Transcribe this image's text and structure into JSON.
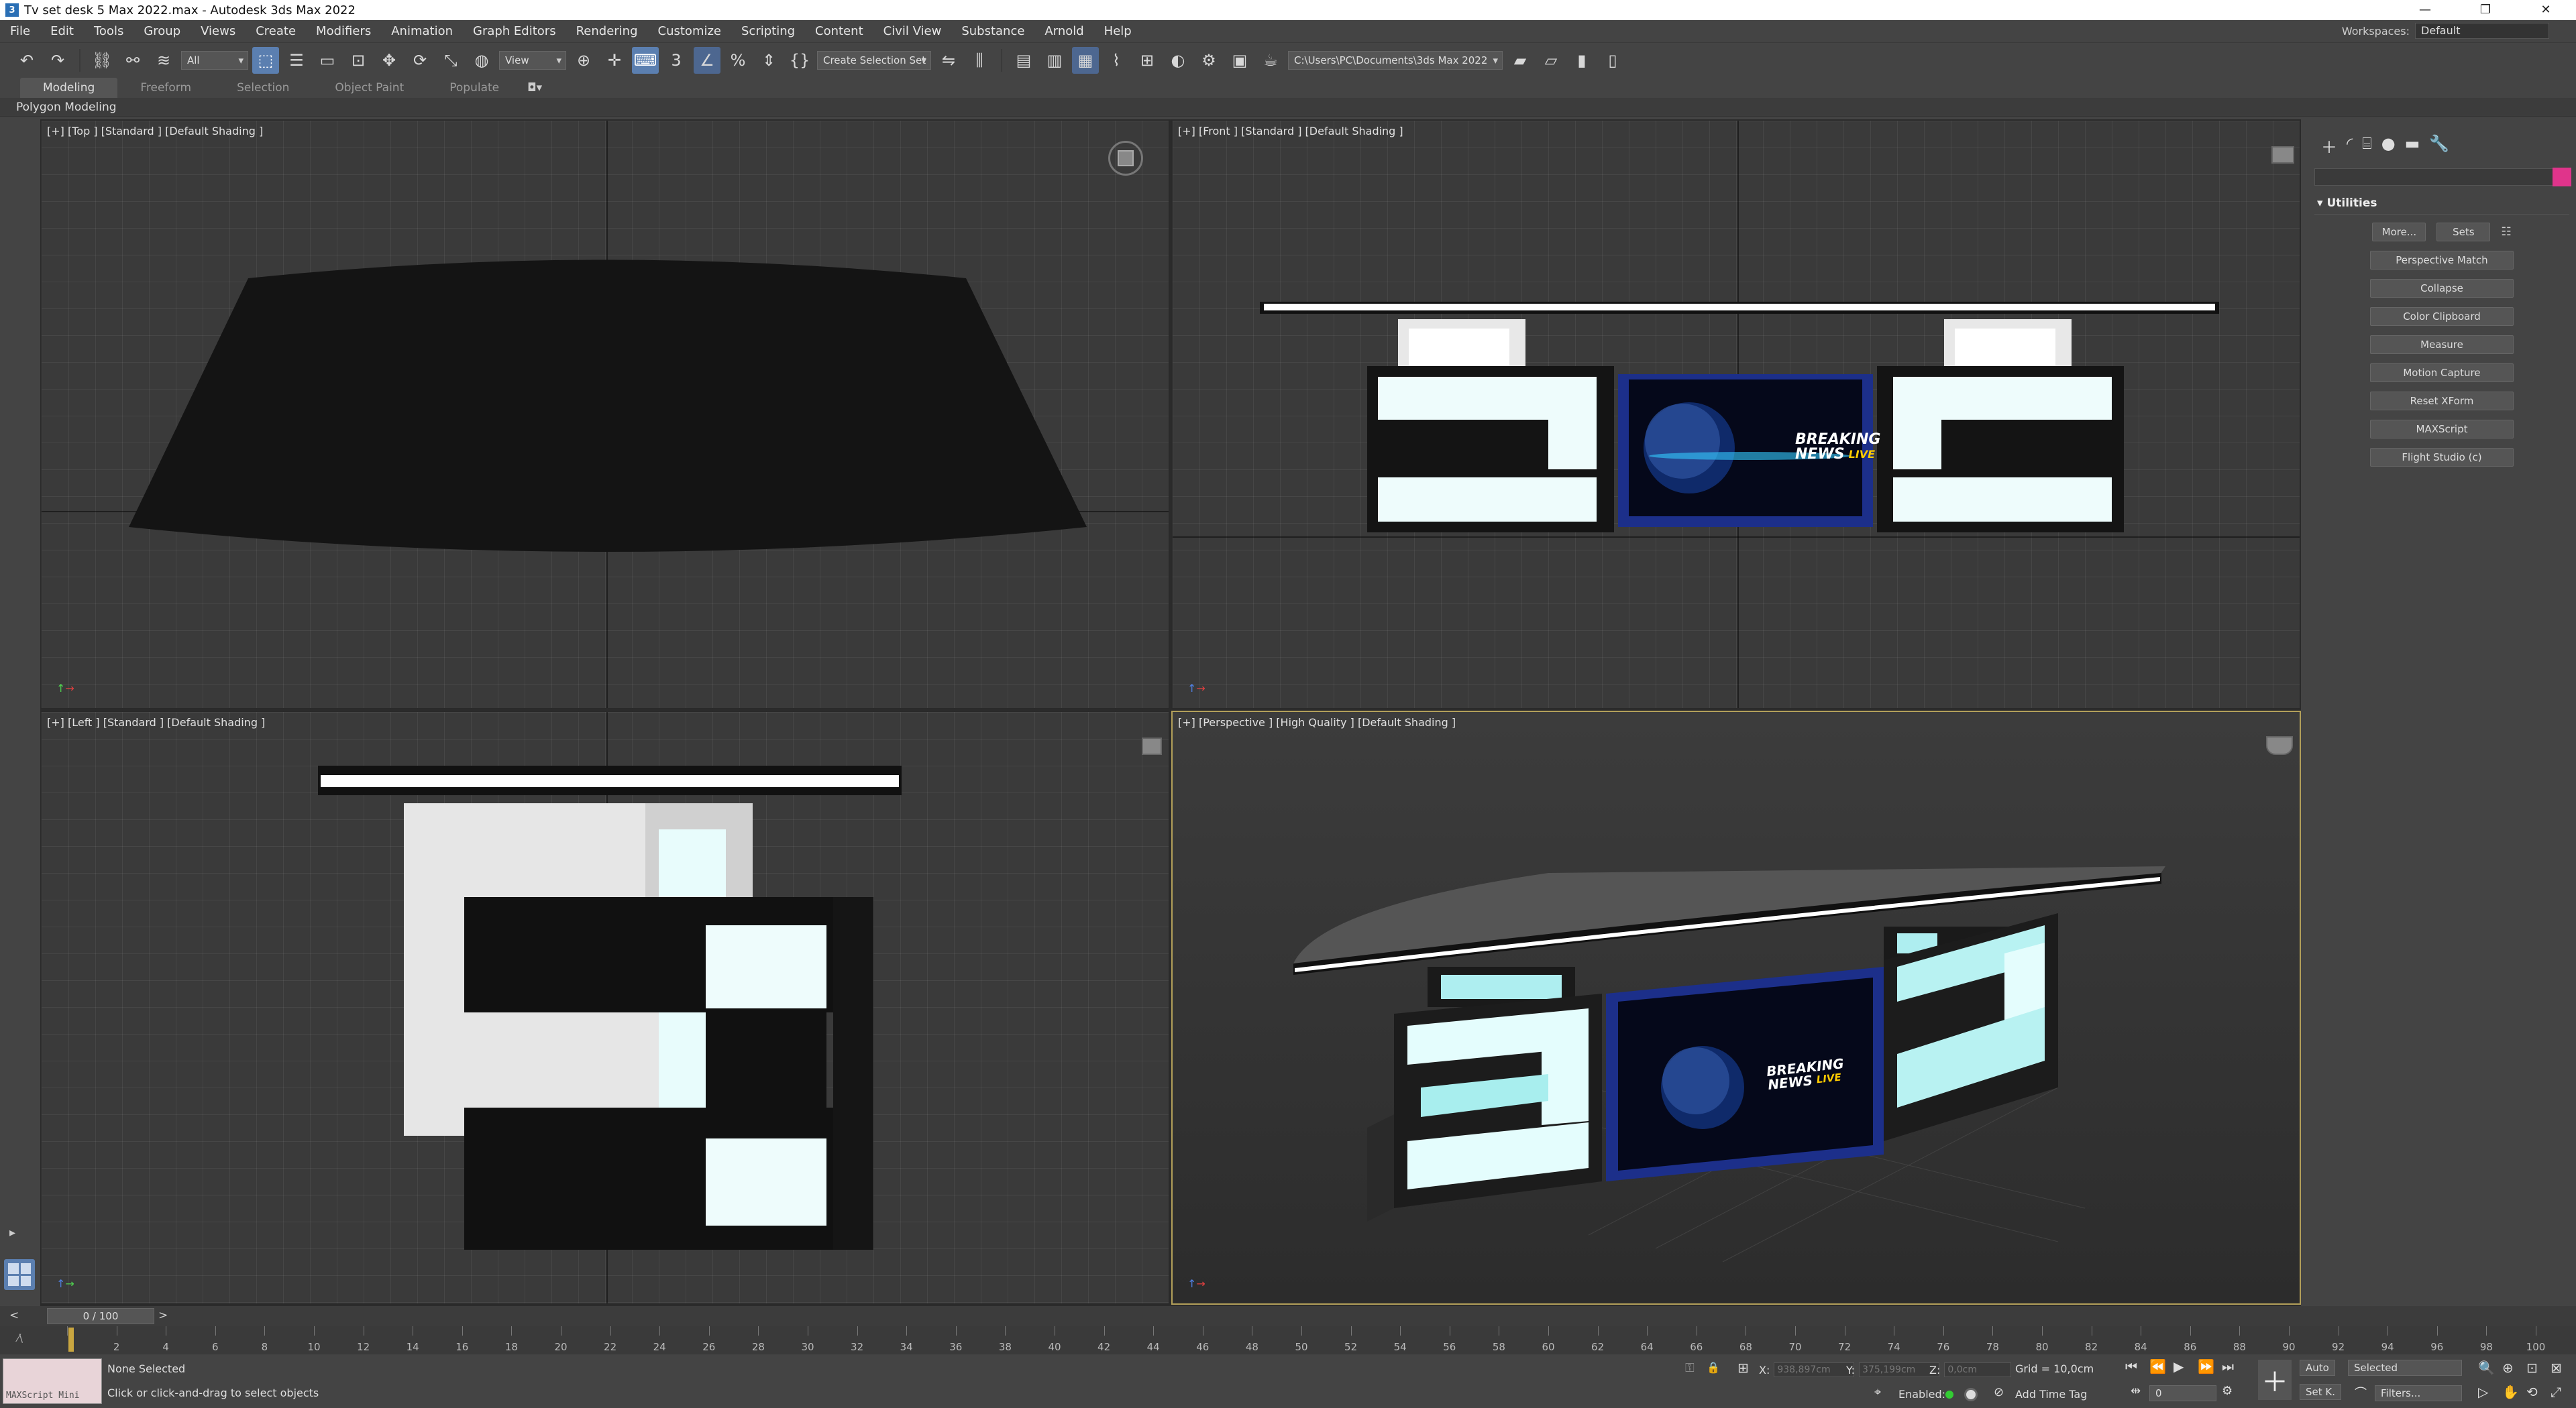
{
  "window": {
    "title": "Tv set desk 5 Max 2022.max - Autodesk 3ds Max 2022",
    "min": "—",
    "restore": "❐",
    "close": "✕"
  },
  "menu": [
    "File",
    "Edit",
    "Tools",
    "Group",
    "Views",
    "Create",
    "Modifiers",
    "Animation",
    "Graph Editors",
    "Rendering",
    "Customize",
    "Scripting",
    "Content",
    "Civil View",
    "Substance",
    "Arnold",
    "Help"
  ],
  "workspaces": {
    "label": "Workspaces:",
    "value": "Default"
  },
  "toolbar": {
    "selection_filter": "All",
    "ref_coord": "View",
    "named_selection": "Create Selection Set",
    "project_path": "C:\\Users\\PC\\Documents\\3ds Max 2022"
  },
  "ribbon": {
    "tabs": [
      "Modeling",
      "Freeform",
      "Selection",
      "Object Paint",
      "Populate"
    ],
    "active": "Modeling",
    "sub": "Polygon Modeling"
  },
  "viewports": {
    "top": "[+] [Top ] [Standard ] [Default Shading ]",
    "front": "[+] [Front ] [Standard ] [Default Shading ]",
    "left": "[+] [Left ] [Standard ] [Default Shading ]",
    "perspective": "[+] [Perspective ] [High Quality ] [Default Shading ]"
  },
  "screen_graphic": {
    "line1": "BREAKING",
    "line2": "NEWS",
    "line3": "LIVE"
  },
  "command_panel": {
    "rollout": "Utilities",
    "more": "More...",
    "sets": "Sets",
    "buttons": [
      "Perspective Match",
      "Collapse",
      "Color Clipboard",
      "Measure",
      "Motion Capture",
      "Reset XForm",
      "MAXScript",
      "Flight Studio (c)"
    ]
  },
  "timeline": {
    "frame": "0 / 100",
    "ticks": [
      "0",
      "2",
      "4",
      "6",
      "8",
      "10",
      "12",
      "14",
      "16",
      "18",
      "20",
      "22",
      "24",
      "26",
      "28",
      "30",
      "32",
      "34",
      "36",
      "38",
      "40",
      "42",
      "44",
      "46",
      "48",
      "50",
      "52",
      "54",
      "56",
      "58",
      "60",
      "62",
      "64",
      "66",
      "68",
      "70",
      "72",
      "74",
      "76",
      "78",
      "80",
      "82",
      "84",
      "86",
      "88",
      "90",
      "92",
      "94",
      "96",
      "98",
      "100"
    ]
  },
  "status": {
    "maxscript": "MAXScript Mini",
    "selection": "None Selected",
    "prompt": "Click or click-and-drag to select objects",
    "x_label": "X:",
    "x_value": "938,897cm",
    "y_label": "Y:",
    "y_value": "375,199cm",
    "z_label": "Z:",
    "z_value": "0,0cm",
    "grid": "Grid = 10,0cm",
    "enabled": "Enabled:",
    "add_time_tag": "Add Time Tag",
    "auto": "Auto",
    "set_key": "Set K.",
    "key_filter": "Selected",
    "filters": "Filters...",
    "current_frame": "0"
  },
  "colors": {
    "accent": "#5b7fb0",
    "swatch": "#e0348b",
    "glow": "#e8ffff",
    "screen_blue": "#1c2f8a"
  }
}
